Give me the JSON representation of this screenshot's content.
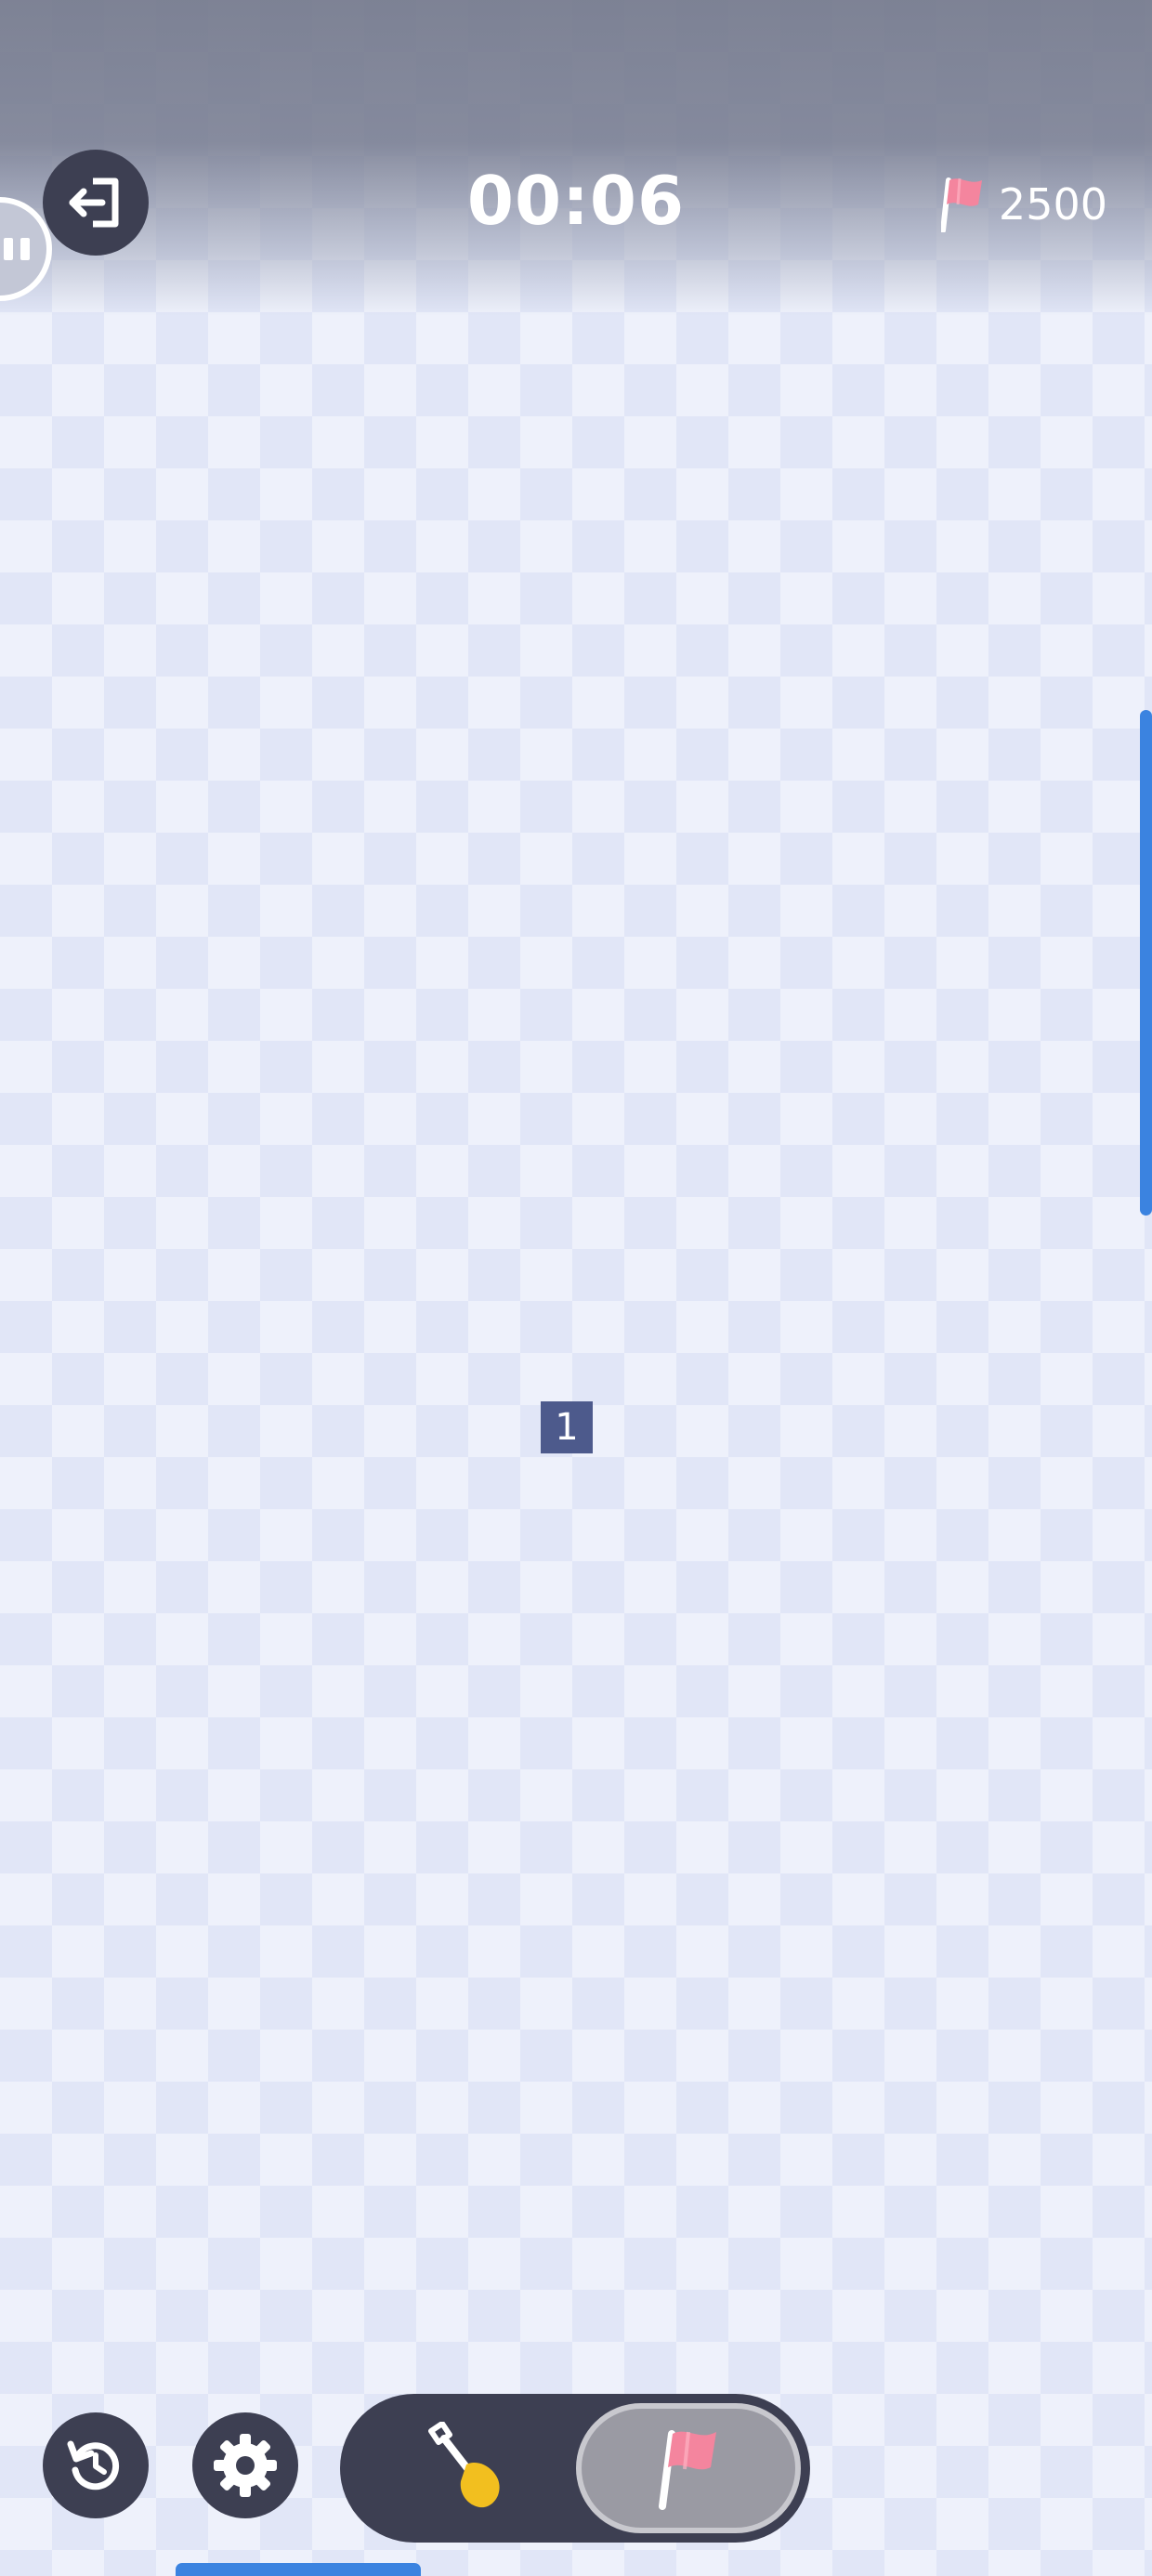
{
  "header": {
    "timer": "00:06",
    "flags_remaining": "2500"
  },
  "board": {
    "revealed_cells": [
      {
        "value": "1"
      }
    ]
  },
  "toolbar": {
    "mode_options": [
      "dig",
      "flag"
    ],
    "selected_mode": "flag"
  },
  "icons": {
    "exit": "exit-icon",
    "pause": "pause-icon",
    "flag": "flag-icon",
    "restart": "restart-icon",
    "settings": "gear-icon",
    "shovel": "shovel-icon"
  },
  "colors": {
    "button_dark": "#3d3f52",
    "flag_pink": "#f4859e",
    "revealed_cell": "#4d5a8c",
    "accent_blue": "#3b83e0",
    "shovel_yellow": "#f2bf1f"
  }
}
